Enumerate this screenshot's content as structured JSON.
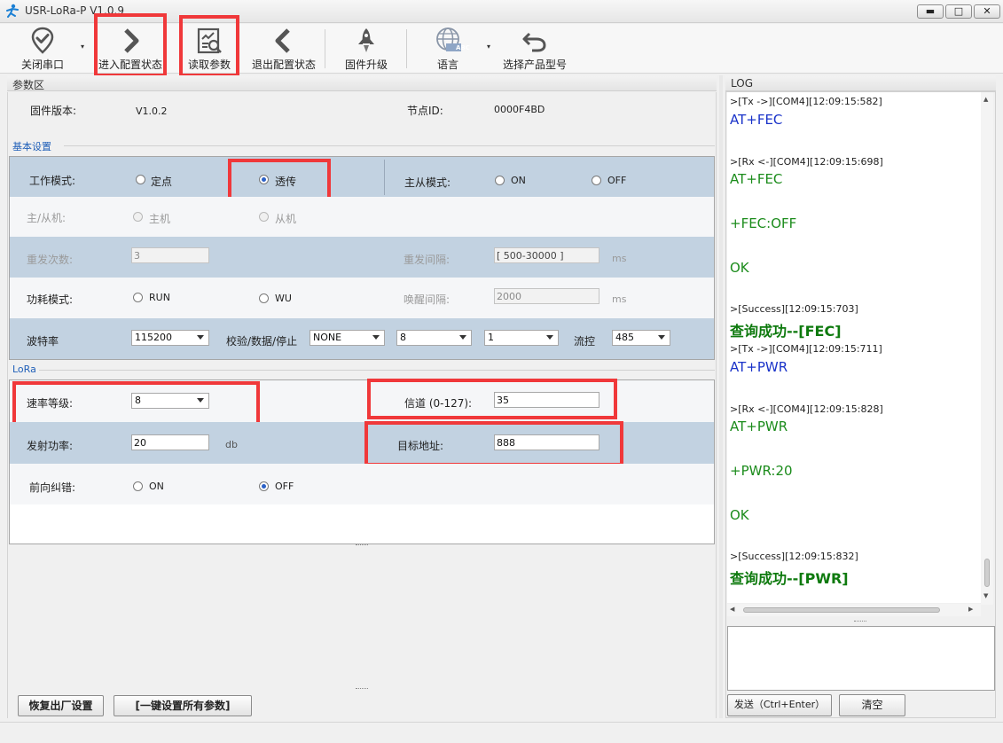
{
  "window": {
    "title": "USR-LoRa-P V1.0.9",
    "controls": {
      "minimize": "▬",
      "maximize": "□",
      "close": "✕"
    }
  },
  "toolbar": {
    "close_port": "关闭串口",
    "enter_config": "进入配置状态",
    "read_params": "读取参数",
    "exit_config": "退出配置状态",
    "firmware_upgrade": "固件升级",
    "language": "语言",
    "language_badge": "ABC",
    "select_model": "选择产品型号",
    "caret": "▾"
  },
  "params": {
    "header": "参数区",
    "firmware_label": "固件版本:",
    "firmware_value": "V1.0.2",
    "node_id_label": "节点ID:",
    "node_id_value": "0000F4BD"
  },
  "basic": {
    "title": "基本设置",
    "work_mode_label": "工作模式:",
    "work_mode_fixed": "定点",
    "work_mode_transparent": "透传",
    "ms_mode_label": "主从模式:",
    "ms_on": "ON",
    "ms_off": "OFF",
    "role_label": "主/从机:",
    "role_master": "主机",
    "role_slave": "从机",
    "retry_count_label": "重发次数:",
    "retry_count_value": "3",
    "retry_interval_label": "重发间隔:",
    "retry_interval_value": "[ 500-30000 ]",
    "retry_interval_unit": "ms",
    "power_mode_label": "功耗模式:",
    "power_run": "RUN",
    "power_wu": "WU",
    "wake_interval_label": "唤醒间隔:",
    "wake_interval_value": "2000",
    "wake_interval_unit": "ms",
    "baud_label": "波特率",
    "baud_value": "115200",
    "parity_label": "校验/数据/停止",
    "parity_value": "NONE",
    "data_bits_value": "8",
    "stop_bits_value": "1",
    "flow_label": "流控",
    "flow_value": "485"
  },
  "lora": {
    "title": "LoRa",
    "rate_label": "速率等级:",
    "rate_value": "8",
    "channel_label": "信道 (0-127):",
    "channel_value": "35",
    "tx_power_label": "发射功率:",
    "tx_power_value": "20",
    "tx_power_unit": "db",
    "target_label": "目标地址:",
    "target_value": "888",
    "fec_label": "前向纠错:",
    "fec_on": "ON",
    "fec_off": "OFF"
  },
  "bottom": {
    "factory_reset": "恢复出厂设置",
    "set_all": "[一键设置所有参数]"
  },
  "log": {
    "header": "LOG",
    "entries": [
      {
        "meta": ">[Tx ->][COM4][12:09:15:582]",
        "text": "AT+FEC"
      },
      {
        "meta": ">[Rx <-][COM4][12:09:15:698]",
        "text": "AT+FEC",
        "text2": "+FEC:OFF",
        "text3": "OK"
      },
      {
        "meta": ">[Success][12:09:15:703]",
        "text": "查询成功--[FEC]"
      },
      {
        "meta": ">[Tx ->][COM4][12:09:15:711]",
        "text": "AT+PWR"
      },
      {
        "meta": ">[Rx <-][COM4][12:09:15:828]",
        "text": "AT+PWR",
        "text2": "+PWR:20",
        "text3": "OK"
      },
      {
        "meta": ">[Success][12:09:15:832]",
        "text": "查询成功--[PWR]"
      }
    ],
    "send_button": "发送（Ctrl+Enter）",
    "clear_button": "清空",
    "input_value": ""
  },
  "colors": {
    "highlight": "#f0383a",
    "row_blue": "#c2d2e1",
    "tx_blue": "#1a33c9",
    "rx_green": "#1c8c1c"
  }
}
